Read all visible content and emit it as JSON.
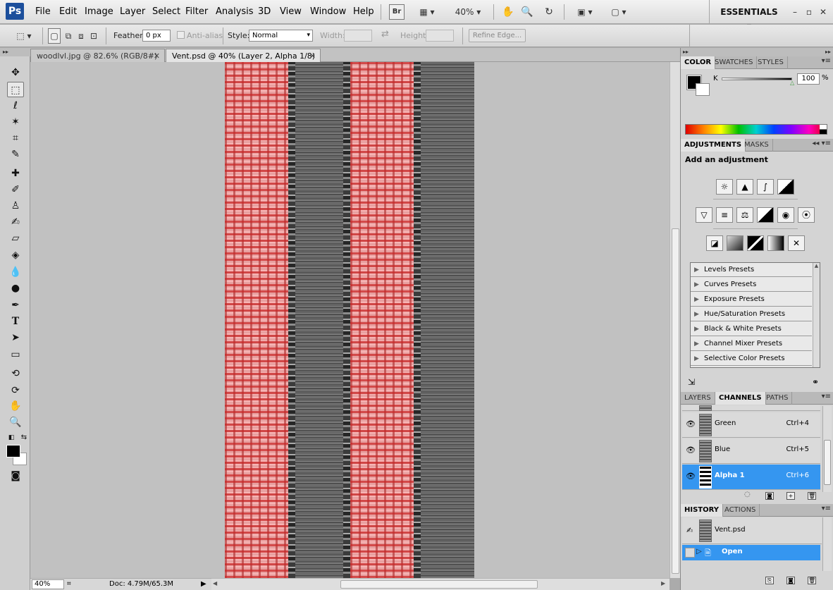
{
  "app": {
    "logo": "Ps",
    "workspace": "ESSENTIALS"
  },
  "menu": [
    "File",
    "Edit",
    "Image",
    "Layer",
    "Select",
    "Filter",
    "Analysis",
    "3D",
    "View",
    "Window",
    "Help"
  ],
  "toolbar": {
    "bridge_label": "Br",
    "zoom": "40%"
  },
  "options": {
    "feather_label": "Feather:",
    "feather_value": "0 px",
    "antialias_label": "Anti-alias",
    "style_label": "Style:",
    "style_value": "Normal",
    "width_label": "Width:",
    "height_label": "Height:",
    "refine_edge": "Refine Edge..."
  },
  "tabs": [
    {
      "label": "woodlvl.jpg @ 82.6% (RGB/8#)"
    },
    {
      "label": "Vent.psd @ 40% (Layer 2, Alpha 1/8)"
    }
  ],
  "status": {
    "zoom": "40%",
    "doc": "Doc: 4.79M/65.3M"
  },
  "color_panel": {
    "tabs": [
      "COLOR",
      "SWATCHES",
      "STYLES"
    ],
    "channel_label": "K",
    "value": "100",
    "unit": "%",
    "k_level": 1.0
  },
  "adjustments": {
    "tabs": [
      "ADJUSTMENTS",
      "MASKS"
    ],
    "title": "Add an adjustment",
    "icons_row1": [
      "brightness-contrast-icon",
      "levels-icon",
      "curves-icon",
      "exposure-icon"
    ],
    "icons_row2": [
      "vibrance-icon",
      "hue-saturation-icon",
      "color-balance-icon",
      "black-white-icon",
      "photo-filter-icon",
      "channel-mixer-icon"
    ],
    "icons_row3": [
      "invert-icon",
      "posterize-icon",
      "threshold-icon",
      "gradient-map-icon",
      "selective-color-icon"
    ],
    "presets": [
      "Levels Presets",
      "Curves Presets",
      "Exposure Presets",
      "Hue/Saturation Presets",
      "Black & White Presets",
      "Channel Mixer Presets",
      "Selective Color Presets"
    ]
  },
  "channels_panel": {
    "tabs": [
      "LAYERS",
      "CHANNELS",
      "PATHS"
    ],
    "rows": [
      {
        "name": "Green",
        "shortcut": "Ctrl+4"
      },
      {
        "name": "Blue",
        "shortcut": "Ctrl+5"
      },
      {
        "name": "Alpha 1",
        "shortcut": "Ctrl+6"
      }
    ]
  },
  "history_panel": {
    "tabs": [
      "HISTORY",
      "ACTIONS"
    ],
    "snapshot": "Vent.psd",
    "states": [
      "Open"
    ]
  },
  "colors": {
    "accent": "#3596f0",
    "brick": "#e8a0a0",
    "metal": "#6a6a6a"
  }
}
